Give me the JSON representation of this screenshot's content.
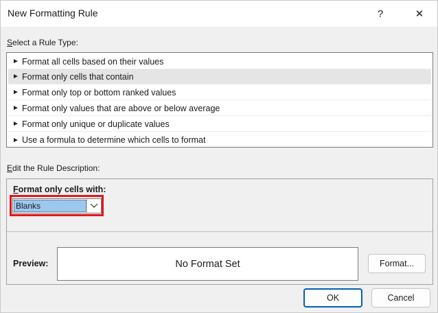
{
  "window": {
    "title": "New Formatting Rule",
    "help_label": "?",
    "close_label": "✕"
  },
  "rule_type": {
    "label_first": "S",
    "label_rest": "elect a Rule Type:",
    "items": [
      {
        "label": "Format all cells based on their values",
        "selected": false
      },
      {
        "label": "Format only cells that contain",
        "selected": true
      },
      {
        "label": "Format only top or bottom ranked values",
        "selected": false
      },
      {
        "label": "Format only values that are above or below average",
        "selected": false
      },
      {
        "label": "Format only unique or duplicate values",
        "selected": false
      },
      {
        "label": "Use a formula to determine which cells to format",
        "selected": false
      }
    ],
    "arrow_glyph": "►"
  },
  "description": {
    "label_first": "E",
    "label_rest": "dit the Rule Description:",
    "format_label_first": "F",
    "format_label_rest": "ormat only cells with:",
    "dropdown_value": "Blanks",
    "highlight_color": "#e0161e",
    "preview_label": "Preview:",
    "preview_text": "No Format Set",
    "format_button": "Format..."
  },
  "footer": {
    "ok_label": "OK",
    "cancel_label": "Cancel"
  }
}
